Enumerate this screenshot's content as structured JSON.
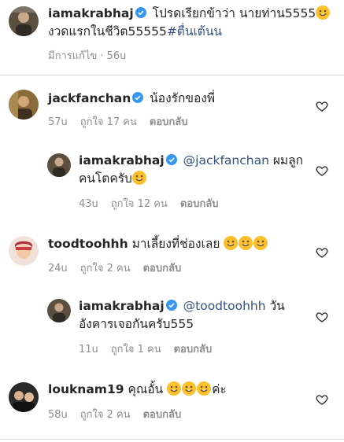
{
  "caption": {
    "username": "iamakrabhaj",
    "text_line1": "โปรดเรียกข้าว่า นายท่าน5555",
    "text_line2_prefix": "งวดแรกในชีวิต55555",
    "hashtag": "#ตื่นเต้นน",
    "edited": "มีการแก้ไข",
    "time": "56u"
  },
  "comments": [
    {
      "username": "jackfanchan",
      "text": "น้องรักของพี่",
      "time": "57u",
      "likes": "ถูกใจ 17 คน",
      "reply": "ตอบกลับ"
    },
    {
      "username": "iamakrabhaj",
      "mention": "@jackfanchan",
      "text_after_mention": " ผมลูก",
      "text_line2": "คนโตครับ",
      "time": "43u",
      "likes": "ถูกใจ 12 คน",
      "reply": "ตอบกลับ"
    },
    {
      "username": "toodtoohhh",
      "text": "มาเลี้ยงที่ช่องเลย",
      "time": "24u",
      "likes": "ถูกใจ 2 คน",
      "reply": "ตอบกลับ"
    },
    {
      "username": "iamakrabhaj",
      "mention": "@toodtoohhh",
      "text_after_mention": " วัน",
      "text_line2": "อังคารเจอกันครับ555",
      "time": "11u",
      "likes": "ถูกใจ 1 คน",
      "reply": "ตอบกลับ"
    },
    {
      "username": "louknam19",
      "text": "คุณอั้น",
      "text_after_emoji": "ค่ะ",
      "time": "58u",
      "likes": "ถูกใจ 2 คน",
      "reply": "ตอบกลับ"
    }
  ],
  "colors": {
    "link": "#385185",
    "meta": "#8e8e8e",
    "verified": "#3897f0"
  }
}
